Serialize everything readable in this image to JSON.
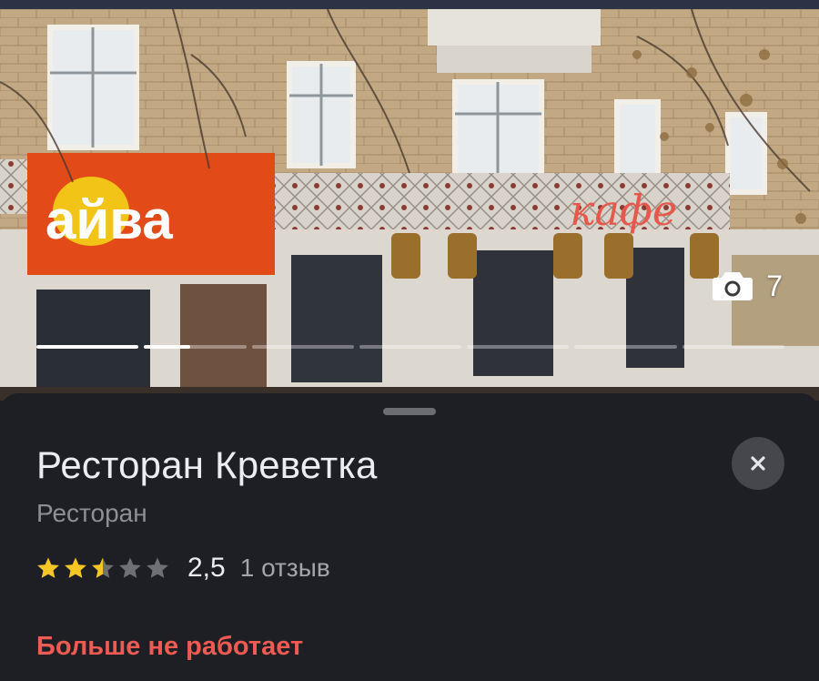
{
  "place": {
    "title": "Ресторан Креветка",
    "category": "Ресторан",
    "rating": {
      "score": "2,5",
      "value": 2.5,
      "max": 5,
      "reviews": "1 отзыв"
    },
    "status": "Больше не работает"
  },
  "photo": {
    "count": "7",
    "sign_main": "айва",
    "sign_secondary": "кафе",
    "progress_segments": [
      1.0,
      0.45,
      0,
      0,
      0,
      0,
      0
    ]
  },
  "colors": {
    "sheet_background": "#1e1f24",
    "title": "#ecedf0",
    "subtitle": "#8e8f94",
    "star_filled": "#f5c624",
    "star_empty": "#6f7075",
    "status_closed": "#ef5a52",
    "close_button": "#46474d"
  },
  "icons": {
    "photo_count": "camera-icon",
    "close": "close-icon",
    "rating": "star-icon"
  }
}
